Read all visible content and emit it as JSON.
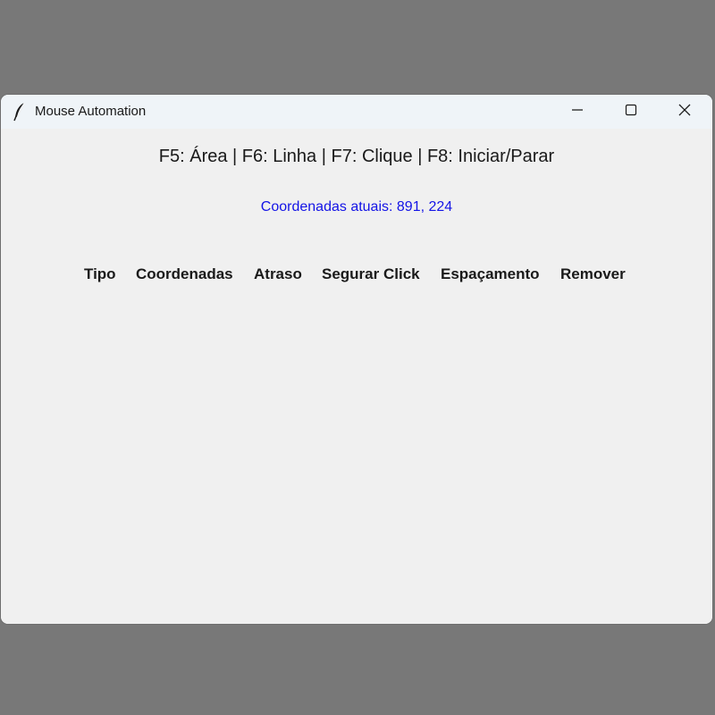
{
  "window": {
    "title": "Mouse Automation",
    "icon": "feather-icon",
    "controls": [
      "minimize-icon",
      "maximize-icon",
      "close-icon"
    ]
  },
  "main": {
    "hotkeys": "F5: Área | F6: Linha | F7: Clique | F8: Iniciar/Parar",
    "coordinates": "Coordenadas atuais: 891, 224",
    "coordinates_color": "#1414e6"
  },
  "table": {
    "columns": [
      "Tipo",
      "Coordenadas",
      "Atraso",
      "Segurar Click",
      "Espaçamento",
      "Remover"
    ],
    "rows": []
  }
}
